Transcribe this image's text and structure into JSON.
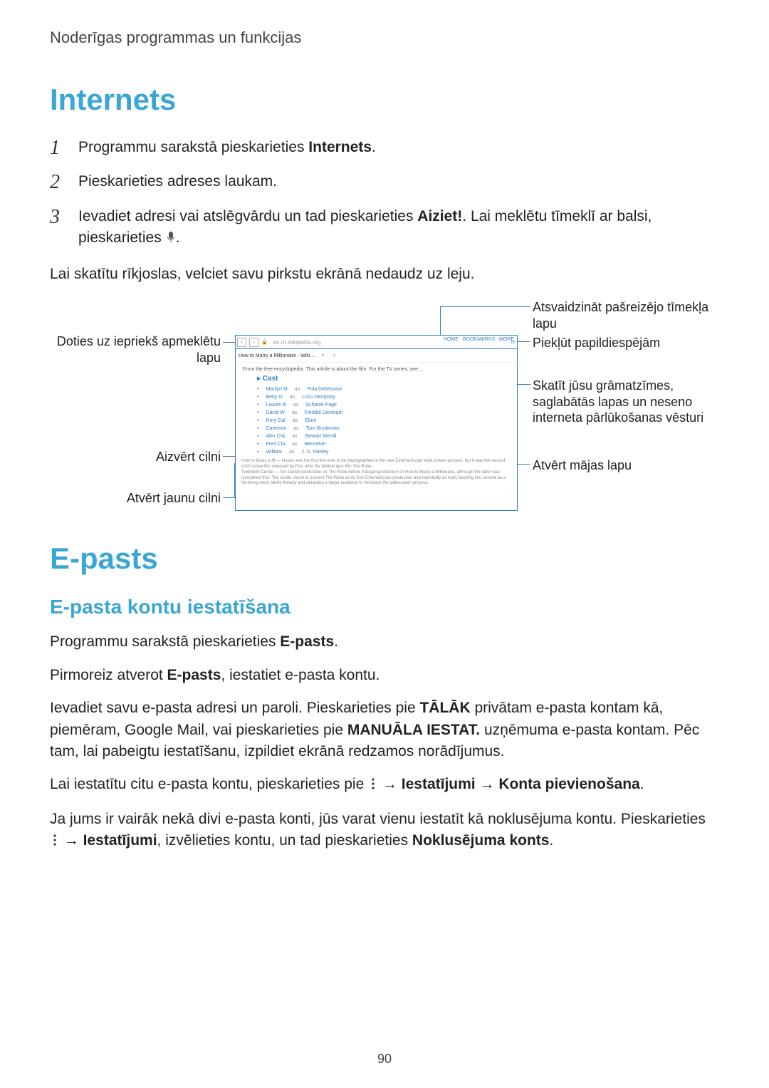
{
  "header": "Noderīgas programmas un funkcijas",
  "sections": {
    "internets": {
      "title": "Internets",
      "step1_a": "Programmu sarakstā pieskarieties ",
      "step1_b": "Internets",
      "step1_c": ".",
      "step2": "Pieskarieties adreses laukam.",
      "step3_a": "Ievadiet adresi vai atslēgvārdu un tad pieskarieties ",
      "step3_b": "Aiziet!",
      "step3_c": ". Lai meklētu tīmeklī ar balsi, pieskarieties ",
      "step3_d": ".",
      "scroll_text": "Lai skatītu rīkjoslas, velciet savu pirkstu ekrānā nedaudz uz leju."
    },
    "diagram": {
      "left": {
        "back": "Doties uz iepriekš apmeklētu lapu",
        "close_tab": "Aizvērt cilni",
        "new_tab": "Atvērt jaunu cilni"
      },
      "right": {
        "refresh": "Atsvaidzināt pašreizējo tīmekļa lapu",
        "options": "Piekļūt papildiespējām",
        "bookmarks": "Skatīt jūsu grāmatzīmes, saglabātās lapas un neseno interneta pārlūkošanas vēsturi",
        "home": "Atvērt mājas lapu"
      }
    },
    "epasts": {
      "title": "E-pasts",
      "subtitle": "E-pasta kontu iestatīšana",
      "p1_a": "Programmu sarakstā pieskarieties ",
      "p1_b": "E-pasts",
      "p1_c": ".",
      "p2_a": "Pirmoreiz atverot ",
      "p2_b": "E-pasts",
      "p2_c": ", iestatiet e-pasta kontu.",
      "p3_a": "Ievadiet savu e-pasta adresi un paroli. Pieskarieties pie ",
      "p3_b": "TĀLĀK",
      "p3_c": " privātam e-pasta kontam kā, piemēram, Google Mail, vai pieskarieties pie ",
      "p3_d": "MANUĀLA IESTAT.",
      "p3_e": " uzņēmuma e-pasta kontam. Pēc tam, lai pabeigtu iestatīšanu, izpildiet ekrānā redzamos norādījumus.",
      "p4_a": "Lai iestatītu citu e-pasta kontu, pieskarieties pie ",
      "p4_b": " → ",
      "p4_c": "Iestatījumi",
      "p4_d": " → ",
      "p4_e": "Konta pievienošana",
      "p4_f": ".",
      "p5_a": "Ja jums ir vairāk nekā divi e-pasta konti, jūs varat vienu iestatīt kā noklusējuma kontu. Pieskarieties ",
      "p5_b": " → ",
      "p5_c": "Iestatījumi",
      "p5_d": ", izvēlieties kontu, un tad pieskarieties ",
      "p5_e": "Noklusējuma konts",
      "p5_f": "."
    }
  },
  "page_number": "90"
}
